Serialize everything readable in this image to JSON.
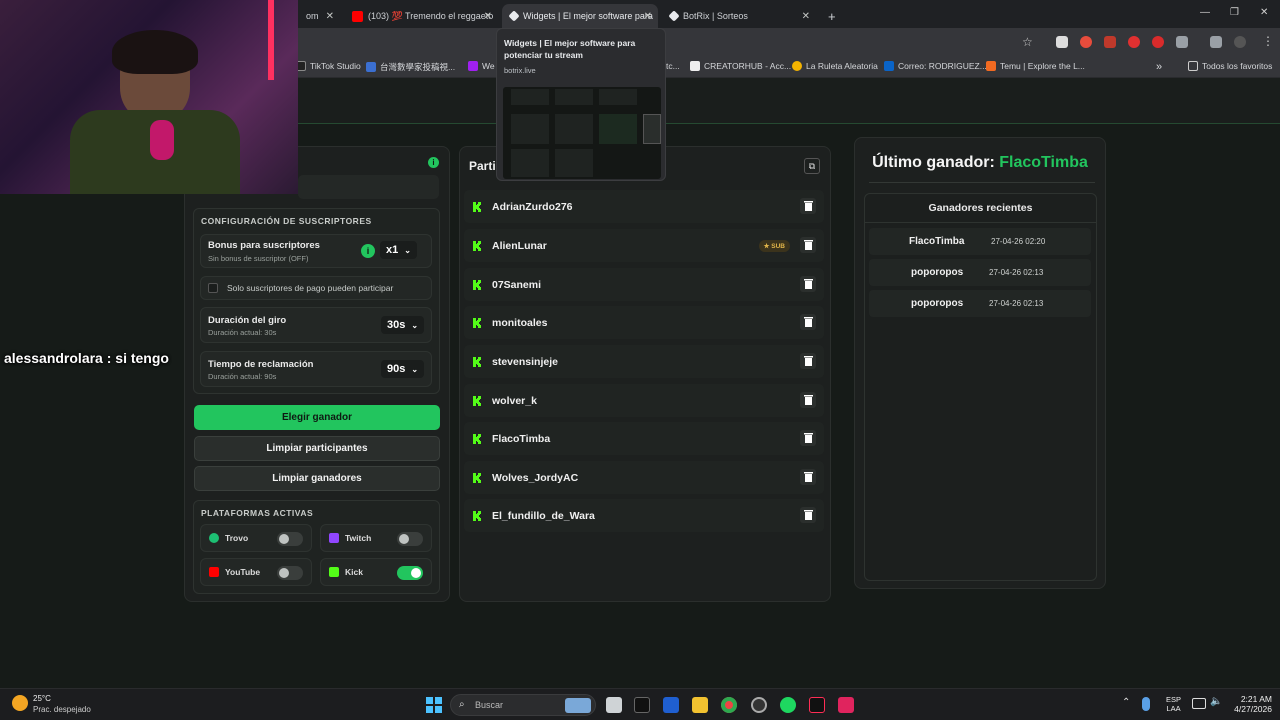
{
  "browser": {
    "tabs": [
      {
        "label": "om",
        "active": false
      },
      {
        "label": "(103) 💯 Tremendo el reggaeto",
        "active": false
      },
      {
        "label": "Widgets | El mejor software para",
        "active": true
      },
      {
        "label": "BotRix | Sorteos",
        "active": false
      }
    ],
    "new_tab": "+",
    "bookmarks": [
      "TikTok Studio",
      "台灣數學家投稿視...",
      "We",
      "tc...",
      "CREATORHUB - Acc...",
      "La Ruleta Aleatoria",
      "Correo: RODRIGUEZ...",
      "Temu | Explore the L..."
    ],
    "bookmarks_more": "»",
    "all_bookmarks": "Todos los favoritos",
    "tab_preview": {
      "title": "Widgets | El mejor software para potenciar tu stream",
      "domain": "botrix.live"
    }
  },
  "stream_overlay": {
    "chat_user": "alessandrolara",
    "chat_text": ": si tengo"
  },
  "config": {
    "section_title": "CONFIGURACIÓN DE SUSCRIPTORES",
    "bonus": {
      "label": "Bonus para suscriptores",
      "sub": "Sin bonus de suscriptor (OFF)",
      "value": "x1"
    },
    "only_paid": {
      "label": "Solo suscriptores de pago pueden participar",
      "checked": false
    },
    "spin": {
      "label": "Duración del giro",
      "sub": "Duración actual: 30s",
      "value": "30s"
    },
    "claim": {
      "label": "Tiempo de reclamación",
      "sub": "Duración actual: 90s",
      "value": "90s"
    },
    "buttons": {
      "pick": "Elegir ganador",
      "clear_participants": "Limpiar participantes",
      "clear_winners": "Limpiar ganadores"
    },
    "platforms_title": "PLATAFORMAS ACTIVAS",
    "platforms": [
      {
        "name": "Trovo",
        "on": false,
        "color": "#1dbf73"
      },
      {
        "name": "Twitch",
        "on": false,
        "color": "#9146ff"
      },
      {
        "name": "YouTube",
        "on": false,
        "color": "#ff0000"
      },
      {
        "name": "Kick",
        "on": true,
        "color": "#53fc18"
      }
    ]
  },
  "participants": {
    "title": "Partic",
    "list": [
      {
        "name": "AdrianZurdo276",
        "sub": false
      },
      {
        "name": "AlienLunar",
        "sub": true
      },
      {
        "name": "07Sanemi",
        "sub": false
      },
      {
        "name": "monitoales",
        "sub": false
      },
      {
        "name": "stevensinjeje",
        "sub": false
      },
      {
        "name": "wolver_k",
        "sub": false
      },
      {
        "name": "FlacoTimba",
        "sub": false
      },
      {
        "name": "Wolves_JordyAC",
        "sub": false
      },
      {
        "name": "El_fundillo_de_Wara",
        "sub": false
      }
    ],
    "sub_badge": "SUB"
  },
  "winner": {
    "title_prefix": "Último ganador:",
    "name": "FlacoTimba",
    "recent_title": "Ganadores recientes",
    "recent": [
      {
        "name": "FlacoTimba",
        "date": "27-04-26 02:20"
      },
      {
        "name": "poporopos",
        "date": "27-04-26 02:13"
      },
      {
        "name": "poporopos",
        "date": "27-04-26 02:13"
      }
    ]
  },
  "taskbar": {
    "weather_temp": "25°C",
    "weather_desc": "Prac. despejado",
    "search": "Buscar",
    "lang_top": "ESP",
    "lang_bottom": "LAA",
    "time": "2:21 AM",
    "date": "4/27/2026"
  },
  "colors": {
    "accent": "#22c55e",
    "kick": "#53fc18"
  }
}
